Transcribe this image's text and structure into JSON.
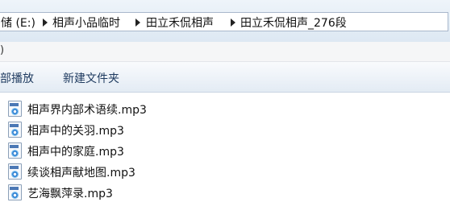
{
  "breadcrumb": {
    "items": [
      "储 (E:)",
      "相声小品临时",
      "田立禾侃相声",
      "田立禾侃相声_276段"
    ]
  },
  "menubar": {
    "label": ")"
  },
  "toolbar": {
    "play_all_label": "部播放",
    "new_folder_label": "新建文件夹"
  },
  "files": [
    {
      "name": "相声界内部术语续.mp3",
      "icon": "mp3-file-icon"
    },
    {
      "name": "相声中的关羽.mp3",
      "icon": "mp3-file-icon"
    },
    {
      "name": "相声中的家庭.mp3",
      "icon": "mp3-file-icon"
    },
    {
      "name": "续谈相声献地图.mp3",
      "icon": "mp3-file-icon"
    },
    {
      "name": "艺海飘萍录.mp3",
      "icon": "mp3-file-icon"
    }
  ]
}
